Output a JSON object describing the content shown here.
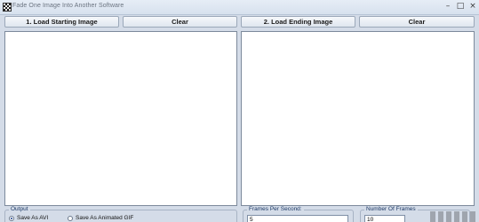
{
  "window": {
    "title": "Fade One Image Into Another Software",
    "minimize_glyph": "–",
    "maximize_glyph": "□",
    "close_glyph": "×"
  },
  "toolbar": {
    "load_start_label": "1. Load Starting Image",
    "clear_start_label": "Clear",
    "load_end_label": "2. Load Ending Image",
    "clear_end_label": "Clear"
  },
  "output": {
    "group_label": "Output",
    "option_avi": "Save As AVI",
    "option_gif": "Save As Animated GIF",
    "selected": "Save As AVI"
  },
  "fps": {
    "group_label": "Frames Per Second:",
    "value": "5"
  },
  "frames": {
    "group_label": "Number Of Frames",
    "value": "10"
  }
}
